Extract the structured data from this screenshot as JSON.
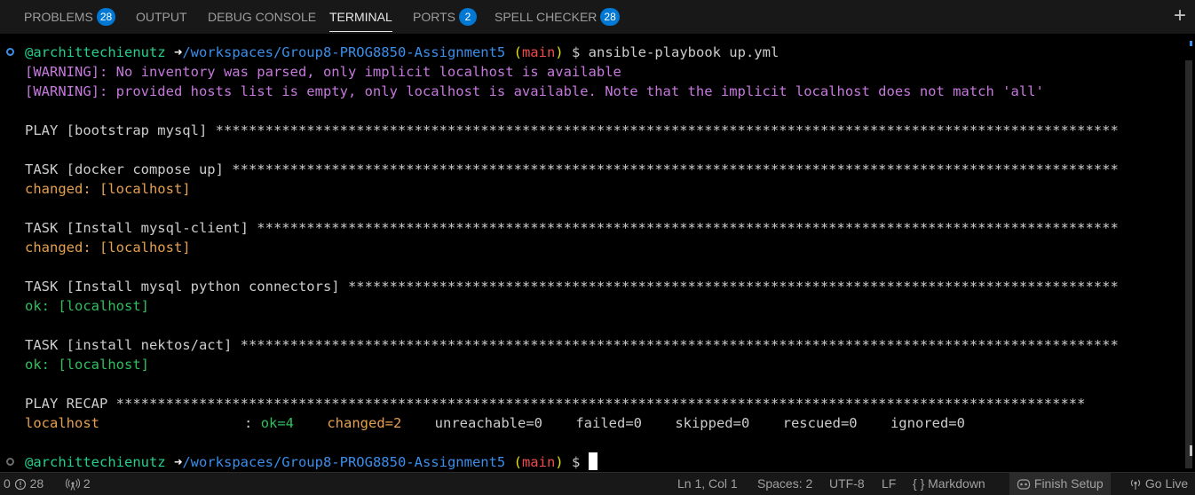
{
  "panel": {
    "tabs": [
      {
        "label": "PROBLEMS",
        "badge": "28"
      },
      {
        "label": "OUTPUT"
      },
      {
        "label": "DEBUG CONSOLE"
      },
      {
        "label": "TERMINAL"
      },
      {
        "label": "PORTS",
        "badge": "2"
      },
      {
        "label": "SPELL CHECKER",
        "badge": "28"
      }
    ],
    "active_tab": "TERMINAL",
    "new_terminal": "+"
  },
  "terminal": {
    "prompt": {
      "user": "@archittechienutz",
      "arrow": "➜",
      "path": "/workspaces/Group8-PROG8850-Assignment5",
      "branch_open": "(",
      "branch": "main",
      "branch_close": ")",
      "dollar": "$"
    },
    "command": "ansible-playbook up.yml",
    "warnings": [
      "[WARNING]: No inventory was parsed, only implicit localhost is available",
      "[WARNING]: provided hosts list is empty, only localhost is available. Note that the implicit localhost does not match 'all'"
    ],
    "play_header": "PLAY [bootstrap mysql] *************************************************************************************************************",
    "tasks": [
      {
        "header": "TASK [docker compose up] ***********************************************************************************************************",
        "result": "changed: [localhost]",
        "status": "changed"
      },
      {
        "header": "TASK [Install mysql-client] ********************************************************************************************************",
        "result": "changed: [localhost]",
        "status": "changed"
      },
      {
        "header": "TASK [Install mysql python connectors] *********************************************************************************************",
        "result": "ok: [localhost]",
        "status": "ok"
      },
      {
        "header": "TASK [install nektos/act] **********************************************************************************************************",
        "result": "ok: [localhost]",
        "status": "ok"
      }
    ],
    "recap_header": "PLAY RECAP *********************************************************************************************************************",
    "recap": {
      "host": "localhost",
      "colon": ":",
      "ok": "ok=4",
      "changed": "changed=2",
      "unreachable": "unreachable=0",
      "failed": "failed=0",
      "skipped": "skipped=0",
      "rescued": "rescued=0",
      "ignored": "ignored=0"
    }
  },
  "statusbar": {
    "errors": "0",
    "warnings": "28",
    "ports": "2",
    "cursor_pos": "Ln 1, Col 1",
    "spaces": "Spaces: 2",
    "encoding": "UTF-8",
    "eol": "LF",
    "language_brace": "{ }",
    "language": "Markdown",
    "finish_setup": "Finish Setup",
    "go_live": "Go Live"
  },
  "colors": {
    "accent_badge": "#0078d4",
    "prompt_user": "#23d18b",
    "prompt_path": "#3b8eea",
    "warning": "#c678dd",
    "changed": "#e5a050",
    "ok": "#2fbf5f",
    "branch": "#f14c4c"
  }
}
